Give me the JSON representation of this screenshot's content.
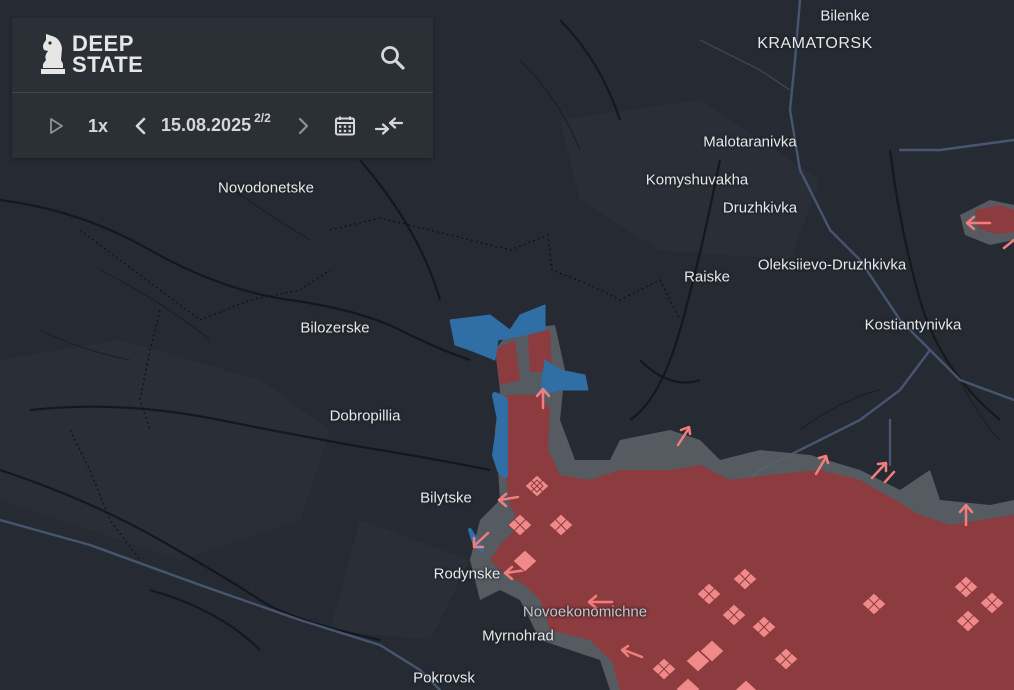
{
  "app": {
    "logo_line1": "DEEP",
    "logo_line2": "STATE"
  },
  "controls": {
    "speed": "1x",
    "date": "15.08.2025",
    "page_indicator": "2/2",
    "icons": [
      "play-icon",
      "chevron-left-icon",
      "chevron-right-icon",
      "calendar-icon",
      "compare-arrows-icon",
      "search-icon"
    ]
  },
  "map": {
    "colors": {
      "background": "#262b33",
      "occupied": "#8f3d3f",
      "contested": "#62656b",
      "liberated": "#2e6ea3",
      "marker": "#f08080",
      "roads": "#4a5a75",
      "rivers": "#14171c"
    },
    "places": [
      {
        "name": "Bilenke",
        "type": "town"
      },
      {
        "name": "KRAMATORSK",
        "type": "city"
      },
      {
        "name": "Malotaranivka",
        "type": "town"
      },
      {
        "name": "Komyshuvakha",
        "type": "town"
      },
      {
        "name": "Druzhkivka",
        "type": "town"
      },
      {
        "name": "Novodonetske",
        "type": "town"
      },
      {
        "name": "Raiske",
        "type": "town"
      },
      {
        "name": "Oleksiievo-Druzhkivka",
        "type": "town"
      },
      {
        "name": "Kostiantynivka",
        "type": "town"
      },
      {
        "name": "Bilozerske",
        "type": "town"
      },
      {
        "name": "Dobropillia",
        "type": "town"
      },
      {
        "name": "Bilytske",
        "type": "town"
      },
      {
        "name": "Rodynske",
        "type": "town"
      },
      {
        "name": "Novoekonomichne",
        "type": "town"
      },
      {
        "name": "Myrnohrad",
        "type": "town"
      },
      {
        "name": "Pokrovsk",
        "type": "town"
      }
    ]
  }
}
